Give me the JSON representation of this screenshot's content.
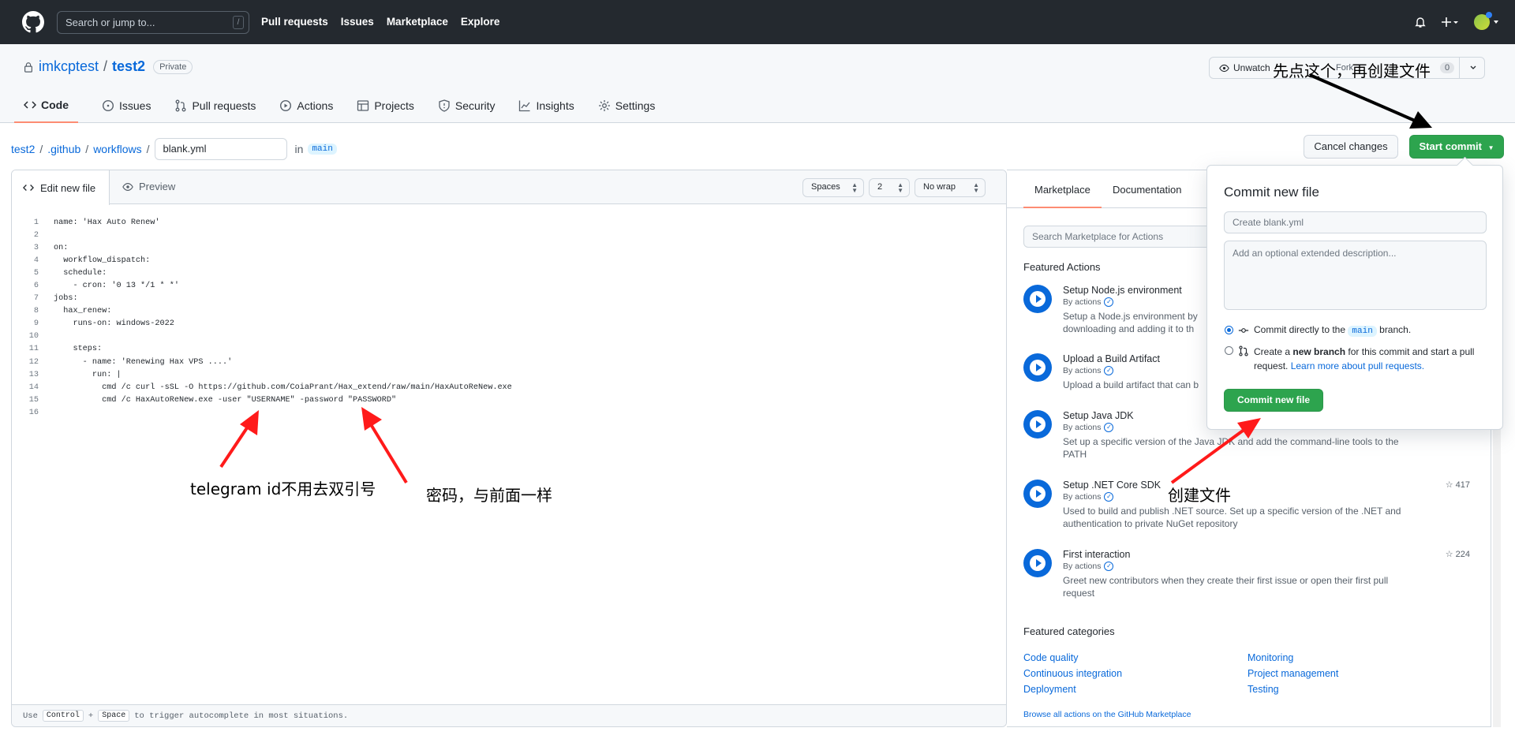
{
  "topbar": {
    "search_placeholder": "Search or jump to...",
    "search_shortcut": "/",
    "nav": [
      "Pull requests",
      "Issues",
      "Marketplace",
      "Explore"
    ]
  },
  "repo": {
    "owner": "imkcptest",
    "sep": "/",
    "name": "test2",
    "visibility": "Private",
    "watch_label": "Unwatch",
    "fork_label": "Fork",
    "fork_count": "0",
    "tabs": [
      "Code",
      "Issues",
      "Pull requests",
      "Actions",
      "Projects",
      "Security",
      "Insights",
      "Settings"
    ]
  },
  "path": {
    "segments": [
      "test2",
      ".github",
      "workflows"
    ],
    "sep": "/",
    "filename": "blank.yml",
    "in_label": "in",
    "branch": "main"
  },
  "buttons": {
    "cancel": "Cancel changes",
    "start_commit": "Start commit"
  },
  "editor": {
    "tab_edit": "Edit new file",
    "tab_preview": "Preview",
    "indent_mode": "Spaces",
    "indent_size": "2",
    "wrap_mode": "No wrap",
    "lines": [
      {
        "n": "1",
        "t": "name: 'Hax Auto Renew'"
      },
      {
        "n": "2",
        "t": ""
      },
      {
        "n": "3",
        "t": "on:"
      },
      {
        "n": "4",
        "t": "  workflow_dispatch:"
      },
      {
        "n": "5",
        "t": "  schedule:"
      },
      {
        "n": "6",
        "t": "    - cron: '0 13 */1 * *'"
      },
      {
        "n": "7",
        "t": "jobs:"
      },
      {
        "n": "8",
        "t": "  hax_renew:"
      },
      {
        "n": "9",
        "t": "    runs-on: windows-2022"
      },
      {
        "n": "10",
        "t": ""
      },
      {
        "n": "11",
        "t": "    steps:"
      },
      {
        "n": "12",
        "t": "      - name: 'Renewing Hax VPS ....'"
      },
      {
        "n": "13",
        "t": "        run: |"
      },
      {
        "n": "14",
        "t": "          cmd /c curl -sSL -O https://github.com/CoiaPrant/Hax_extend/raw/main/HaxAutoReNew.exe"
      },
      {
        "n": "15",
        "t": "          cmd /c HaxAutoReNew.exe -user \"USERNAME\" -password \"PASSWORD\""
      },
      {
        "n": "16",
        "t": ""
      }
    ],
    "footer_use": "Use",
    "footer_key1": "Control",
    "footer_plus": "+",
    "footer_key2": "Space",
    "footer_rest": "to trigger autocomplete in most situations."
  },
  "marketplace": {
    "tabs": [
      "Marketplace",
      "Documentation"
    ],
    "search_placeholder": "Search Marketplace for Actions",
    "featured_actions_title": "Featured Actions",
    "actions": [
      {
        "title": "Setup Node.js environment",
        "by": "By actions",
        "desc": "Setup a Node.js environment by",
        "desc2": "downloading and adding it to th",
        "stars": ""
      },
      {
        "title": "Upload a Build Artifact",
        "by": "By actions",
        "desc": "Upload a build artifact that can b",
        "desc2": "",
        "stars": ""
      },
      {
        "title": "Setup Java JDK",
        "by": "By actions",
        "desc": "Set up a specific version of the Java JDK and add the command-line tools to the",
        "desc2": "PATH",
        "stars": ""
      },
      {
        "title": "Setup .NET Core SDK",
        "by": "By actions",
        "desc": "Used to build and publish .NET source. Set up a specific version of the .NET and",
        "desc2": "authentication to private NuGet repository",
        "stars": "417"
      },
      {
        "title": "First interaction",
        "by": "By actions",
        "desc": "Greet new contributors when they create their first issue or open their first pull",
        "desc2": "request",
        "stars": "224"
      }
    ],
    "featured_categories_title": "Featured categories",
    "categories": [
      "Code quality",
      "Monitoring",
      "Continuous integration",
      "Project management",
      "Deployment",
      "Testing"
    ],
    "browse_link": "Browse all actions on the GitHub Marketplace"
  },
  "commit_popup": {
    "title": "Commit new file",
    "summary_placeholder": "Create blank.yml",
    "description_placeholder": "Add an optional extended description...",
    "option1_prefix": "Commit directly to the",
    "option1_branch": "main",
    "option1_suffix": "branch.",
    "option2_prefix": "Create a",
    "option2_bold": "new branch",
    "option2_suffix": "for this commit and start a pull request.",
    "option2_link": "Learn more about pull requests.",
    "commit_button": "Commit new file"
  },
  "annotations": {
    "top": "先点这个，再创建文件",
    "username": "telegram id不用去双引号",
    "password": "密码，与前面一样",
    "commit": "创建文件",
    "color": "#ff1a1a"
  }
}
